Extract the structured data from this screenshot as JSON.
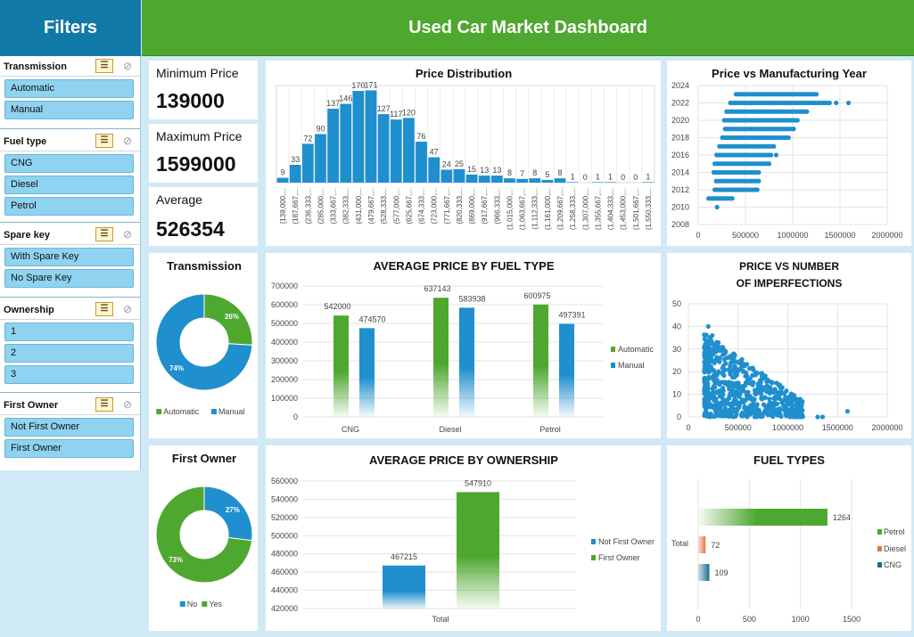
{
  "header": {
    "title": "Used Car Market Dashboard"
  },
  "sidebar": {
    "title": "Filters",
    "slicers": [
      {
        "title": "Transmission",
        "items": [
          "Automatic",
          "Manual"
        ]
      },
      {
        "title": "Fuel type",
        "items": [
          "CNG",
          "Diesel",
          "Petrol"
        ]
      },
      {
        "title": "Spare key",
        "items": [
          "With Spare Key",
          "No Spare Key"
        ]
      },
      {
        "title": "Ownership",
        "items": [
          "1",
          "2",
          "3"
        ]
      },
      {
        "title": "First Owner",
        "items": [
          "Not First Owner",
          "First Owner"
        ]
      }
    ],
    "icons": {
      "multiselect": "multiselect-icon",
      "clear": "clear-filter-icon"
    }
  },
  "kpis": {
    "min": {
      "label": "Minimum Price",
      "value": "139000"
    },
    "max": {
      "label": "Maximum Price",
      "value": "1599000"
    },
    "avg": {
      "label": "Average",
      "value": "526354"
    }
  },
  "colors": {
    "green": "#4ea72e",
    "blue": "#1f8fce",
    "orange": "#e9734a",
    "teal": "#1a6e8e"
  },
  "chart_data": [
    {
      "id": "price-distribution",
      "type": "bar",
      "title": "Price Distribution",
      "categories": [
        "[139,000,...",
        "(187,667,...",
        "(236,333,...",
        "(285,000,...",
        "(333,667,...",
        "(382,333,...",
        "(431,000,...",
        "(479,667,...",
        "(528,333,...",
        "(577,000,...",
        "(625,667,...",
        "(674,333,...",
        "(723,000,...",
        "(771,667,...",
        "(820,333,...",
        "(869,000,...",
        "(917,667,...",
        "(966,333,...",
        "(1,015,000,...",
        "(1,063,667,...",
        "(1,112,333,...",
        "(1,161,000,...",
        "(1,209,667,...",
        "(1,258,333,...",
        "(1,307,000,...",
        "(1,355,667,...",
        "(1,404,333,...",
        "(1,453,000,...",
        "(1,501,667,...",
        "(1,550,333,..."
      ],
      "values": [
        9,
        33,
        72,
        90,
        137,
        146,
        170,
        171,
        127,
        117,
        120,
        76,
        47,
        24,
        25,
        15,
        13,
        13,
        8,
        7,
        8,
        5,
        8,
        1,
        0,
        1,
        1,
        0,
        0,
        1
      ],
      "ylim": [
        0,
        180
      ]
    },
    {
      "id": "price-vs-year",
      "type": "scatter",
      "title": "Price vs Manufacturing Year",
      "xlim": [
        0,
        2000000
      ],
      "ylim": [
        2008,
        2024
      ],
      "xticks": [
        "0",
        "500000",
        "1000000",
        "1500000",
        "2000000"
      ],
      "yticks": [
        "2008",
        "2010",
        "2012",
        "2014",
        "2016",
        "2018",
        "2020",
        "2022",
        "2024"
      ],
      "rows": [
        {
          "year": 2012,
          "min": 175000,
          "max": 640000,
          "extra": []
        },
        {
          "year": 2013,
          "min": 190000,
          "max": 650000,
          "extra": []
        },
        {
          "year": 2014,
          "min": 165000,
          "max": 640000,
          "extra": []
        },
        {
          "year": 2015,
          "min": 175000,
          "max": 760000,
          "extra": []
        },
        {
          "year": 2016,
          "min": 195000,
          "max": 770000,
          "extra": [
            825000
          ]
        },
        {
          "year": 2017,
          "min": 225000,
          "max": 820000,
          "extra": []
        },
        {
          "year": 2018,
          "min": 255000,
          "max": 960000,
          "extra": []
        },
        {
          "year": 2019,
          "min": 285000,
          "max": 1030000,
          "extra": []
        },
        {
          "year": 2020,
          "min": 275000,
          "max": 1050000,
          "extra": []
        },
        {
          "year": 2021,
          "min": 300000,
          "max": 1150000,
          "extra": []
        },
        {
          "year": 2022,
          "min": 340000,
          "max": 1390000,
          "extra": [
            1460000,
            1590000
          ]
        },
        {
          "year": 2023,
          "min": 400000,
          "max": 1250000,
          "extra": []
        },
        {
          "year": 2011,
          "min": 110000,
          "max": 380000,
          "extra": []
        },
        {
          "year": 2010,
          "min": 200000,
          "max": 200000,
          "extra": []
        }
      ]
    },
    {
      "id": "transmission-donut",
      "type": "pie",
      "title": "Transmission",
      "slices": [
        {
          "name": "Automatic",
          "value": 26,
          "label": "26%"
        },
        {
          "name": "Manual",
          "value": 74,
          "label": "74%"
        }
      ],
      "legend": "bottom"
    },
    {
      "id": "avg-price-fuel",
      "type": "bar",
      "title": "AVERAGE PRICE BY FUEL TYPE",
      "categories": [
        "CNG",
        "Diesel",
        "Petrol"
      ],
      "series": [
        {
          "name": "Automatic",
          "values": [
            542000,
            637143,
            600975
          ]
        },
        {
          "name": "Manual",
          "values": [
            474570,
            583938,
            497391
          ]
        }
      ],
      "ylim": [
        0,
        700000
      ],
      "yticks": [
        "0",
        "100000",
        "200000",
        "300000",
        "400000",
        "500000",
        "600000",
        "700000"
      ],
      "legend": "right"
    },
    {
      "id": "price-vs-imperfections",
      "type": "scatter",
      "title": "PRICE VS NUMBER OF IMPERFECTIONS",
      "xlim": [
        0,
        2000000
      ],
      "ylim": [
        0,
        50
      ],
      "xticks": [
        "0",
        "500000",
        "1000000",
        "1500000",
        "2000000"
      ],
      "yticks": [
        "0",
        "10",
        "20",
        "30",
        "40",
        "50"
      ]
    },
    {
      "id": "first-owner-donut",
      "type": "pie",
      "title": "First Owner",
      "slices": [
        {
          "name": "No",
          "value": 27,
          "label": "27%"
        },
        {
          "name": "Yes",
          "value": 73,
          "label": "73%"
        }
      ],
      "legend": "bottom"
    },
    {
      "id": "avg-price-ownership",
      "type": "bar",
      "title": "AVERAGE PRICE BY OWNERSHIP",
      "categories": [
        "Total"
      ],
      "series": [
        {
          "name": "Not First Owner",
          "values": [
            467215
          ]
        },
        {
          "name": "First Owner",
          "values": [
            547910
          ]
        }
      ],
      "ylim": [
        420000,
        560000
      ],
      "yticks": [
        "420000",
        "440000",
        "460000",
        "480000",
        "500000",
        "520000",
        "540000",
        "560000"
      ],
      "legend": "right"
    },
    {
      "id": "fuel-types",
      "type": "bar",
      "title": "FUEL TYPES",
      "categories": [
        "Total"
      ],
      "series": [
        {
          "name": "Petrol",
          "values": [
            1264
          ]
        },
        {
          "name": "Diesel",
          "values": [
            72
          ]
        },
        {
          "name": "CNG",
          "values": [
            109
          ]
        }
      ],
      "xlim": [
        0,
        1500
      ],
      "xticks": [
        "0",
        "500",
        "1000",
        "1500"
      ],
      "legend": "right"
    }
  ]
}
